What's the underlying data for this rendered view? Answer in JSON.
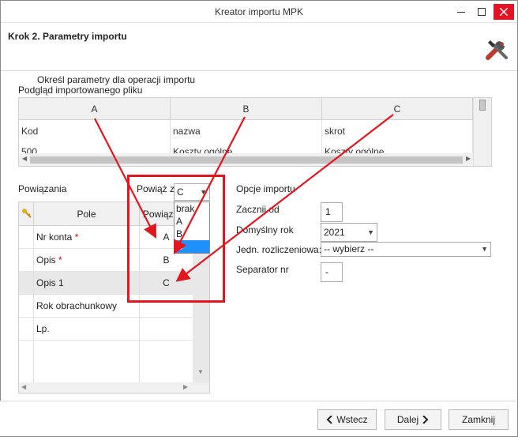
{
  "window": {
    "title": "Kreator importu MPK"
  },
  "header": {
    "step": "Krok 2. Parametry importu"
  },
  "intro": {
    "instructions": "Określ parametry dla operacji importu",
    "preview_label": "Podgląd importowanego pliku"
  },
  "preview": {
    "columns": [
      "A",
      "B",
      "C"
    ],
    "rows": [
      [
        "Kod",
        "nazwa",
        "skrot"
      ],
      [
        "500",
        "Koszty ogólne",
        "Koszty ogólne"
      ]
    ]
  },
  "associations": {
    "label": "Powiązania",
    "bind_from_label": "Powiąż z:",
    "bind_from_value": "C",
    "bind_options": [
      "brak",
      "A",
      "B",
      "C"
    ],
    "bind_selected_index": 3,
    "columns": [
      "Pole",
      "Powiązanie"
    ],
    "rows": [
      {
        "field": "Nr konta",
        "required": true,
        "binding": "A"
      },
      {
        "field": "Opis",
        "required": true,
        "binding": "B"
      },
      {
        "field": "Opis 1",
        "required": false,
        "binding": "C"
      },
      {
        "field": "Rok obrachunkowy",
        "required": false,
        "binding": ""
      },
      {
        "field": "Lp.",
        "required": false,
        "binding": ""
      }
    ]
  },
  "options": {
    "label": "Opcje importu",
    "start_from_label": "Zacznij od",
    "start_from_value": "1",
    "default_year_label": "Domyślny rok",
    "default_year_value": "2021",
    "unit_label": "Jedn. rozliczeniowa:",
    "unit_value": "-- wybierz --",
    "separator_label": "Separator nr",
    "separator_value": "-"
  },
  "footer": {
    "back_label": "Wstecz",
    "next_label": "Dalej",
    "close_label": "Zamknij"
  },
  "colors": {
    "accent": "#1e90ff",
    "annotation": "#e4151c",
    "close_button": "#e81123"
  }
}
